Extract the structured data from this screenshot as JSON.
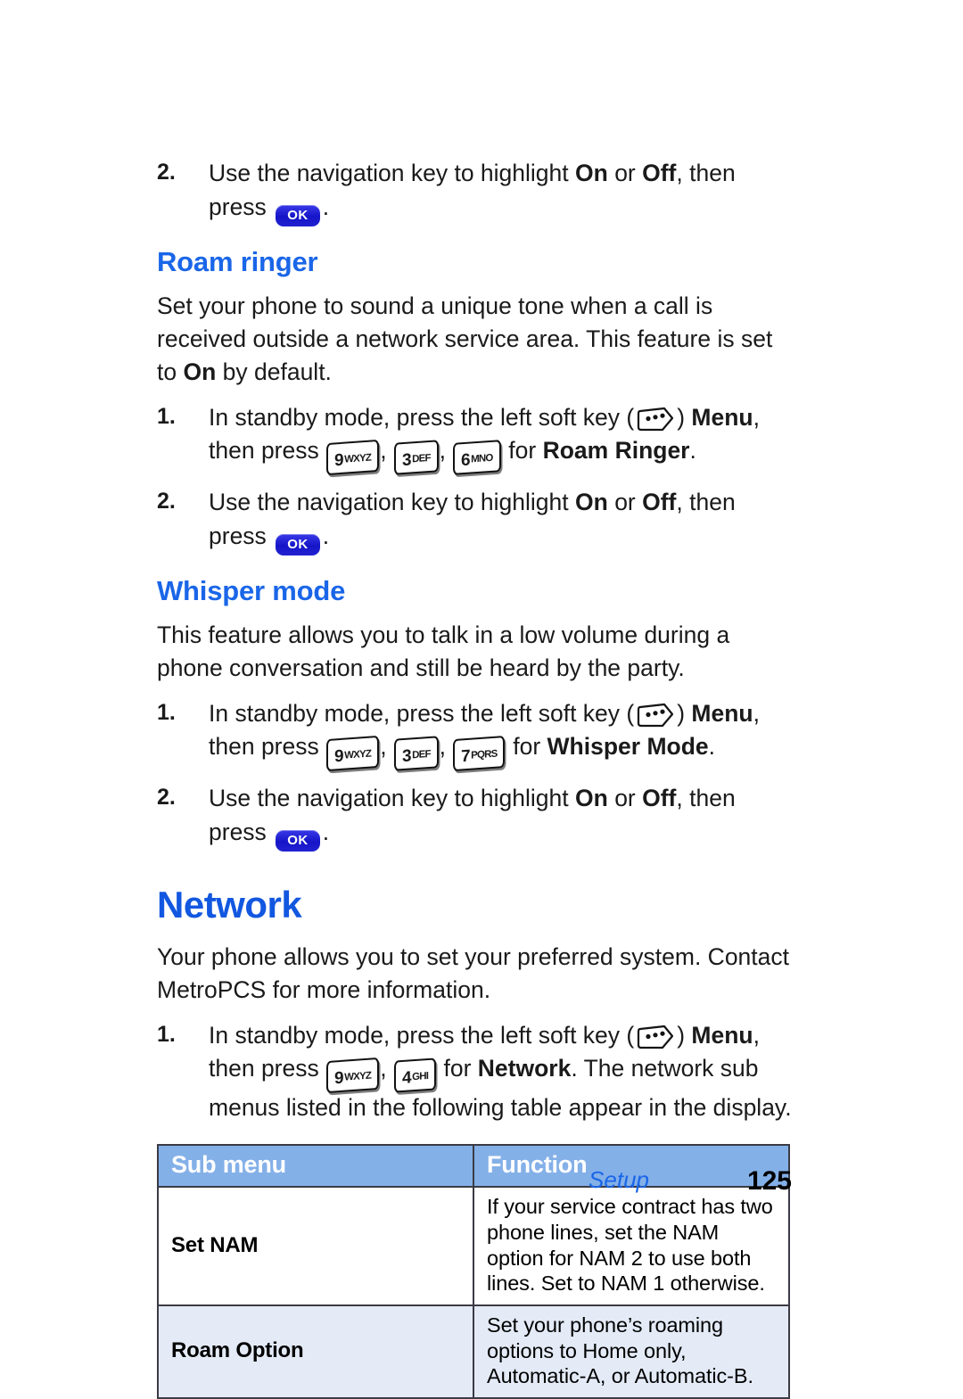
{
  "page": {
    "number": "125",
    "chapter_label": "Setup",
    "accent_heading_color": "#1a66e8",
    "accent_chapter_color": "#1257e0",
    "table_header_bg": "#84b0e8",
    "table_tint_row_bg": "#e4ebf7",
    "ok_key_color": "#1a1ad6"
  },
  "top_step": {
    "number": "2.",
    "text_before": "Use the navigation key to highlight ",
    "bold_on": "On",
    "text_or": " or ",
    "bold_off": "Off",
    "text_after": ", then press",
    "ok_key_label": "OK",
    "period": "."
  },
  "roam_ringer": {
    "heading": "Roam ringer",
    "paragraph": "Set your phone to sound a unique tone when a call is received outside a network service area. This feature is set to ",
    "paragraph_bold": "On",
    "paragraph_end": " by default.",
    "steps": [
      {
        "number": "1.",
        "lead": "In standby mode, press the left soft key (",
        "soft_key_icon": "soft-key-icon",
        "after_icon": ") ",
        "menu_bold": "Menu",
        "then_press": ", then press",
        "keys": [
          {
            "digit": "9",
            "letters": "WXYZ"
          },
          {
            "digit": "3",
            "letters": "DEF"
          },
          {
            "digit": "6",
            "letters": "MNO"
          }
        ],
        "for_text": "for ",
        "target_bold": "Roam Ringer",
        "period": "."
      },
      {
        "number": "2.",
        "text_before": "Use the navigation key to highlight ",
        "bold_on": "On",
        "text_or": " or ",
        "bold_off": "Off",
        "text_after": ", then press",
        "ok_key_label": "OK",
        "period": "."
      }
    ]
  },
  "whisper_mode": {
    "heading": "Whisper mode",
    "paragraph": "This feature allows you to talk in a low volume during a phone conversation and still be heard by the party.",
    "steps": [
      {
        "number": "1.",
        "lead": "In standby mode, press the left soft key (",
        "soft_key_icon": "soft-key-icon",
        "after_icon": ") ",
        "menu_bold": "Menu",
        "then_press": ", then press",
        "keys": [
          {
            "digit": "9",
            "letters": "WXYZ"
          },
          {
            "digit": "3",
            "letters": "DEF"
          },
          {
            "digit": "7",
            "letters": "PQRS"
          }
        ],
        "for_text": "for ",
        "target_bold": "Whisper Mode",
        "period": "."
      },
      {
        "number": "2.",
        "text_before": "Use the navigation key to highlight ",
        "bold_on": "On",
        "text_or": " or ",
        "bold_off": "Off",
        "text_after": ", then press",
        "ok_key_label": "OK",
        "period": "."
      }
    ]
  },
  "network": {
    "heading": "Network",
    "paragraph": "Your phone allows you to set your preferred system. Contact MetroPCS for more information.",
    "step": {
      "number": "1.",
      "lead": "In standby mode, press the left soft key (",
      "soft_key_icon": "soft-key-icon",
      "after_icon": ") ",
      "menu_bold": "Menu",
      "then_press": ", then press",
      "keys": [
        {
          "digit": "9",
          "letters": "WXYZ"
        },
        {
          "digit": "4",
          "letters": "GHI"
        }
      ],
      "for_text": "for ",
      "target_bold": "Network",
      "tail": ". The network sub menus listed in the following table appear in the display."
    },
    "table": {
      "headers": [
        "Sub menu",
        "Function"
      ],
      "rows": [
        {
          "label": "Set NAM",
          "function": "If your service contract has two phone lines, set the NAM option for NAM 2 to use both lines. Set to NAM 1 otherwise.",
          "tint": false
        },
        {
          "label": "Roam Option",
          "function": "Set your phone’s roaming options to Home only, Automatic-A, or Automatic-B.",
          "tint": true
        }
      ]
    }
  }
}
